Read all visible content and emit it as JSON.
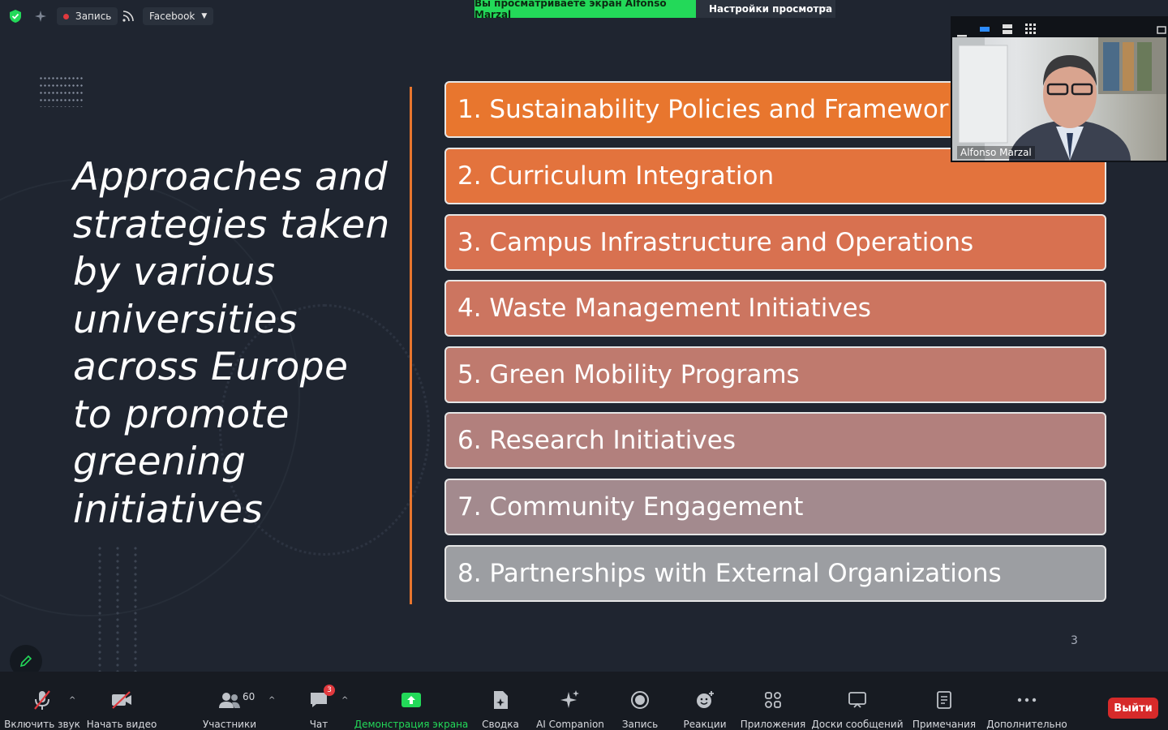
{
  "topbar": {
    "record_label": "Запись",
    "stream_label": "Facebook",
    "share_banner": "Вы просматриваете экран Alfonso Marzal",
    "view_settings": "Настройки просмотра"
  },
  "slide": {
    "title": "Approaches and strategies taken by various universities across Europe to promote greening initiatives",
    "items": [
      {
        "label": "1. Sustainability Policies and Frameworks",
        "color": "#e8762e"
      },
      {
        "label": "2. Curriculum Integration",
        "color": "#e3733d"
      },
      {
        "label": "3. Campus Infrastructure and Operations",
        "color": "#d87150"
      },
      {
        "label": "4. Waste Management Initiatives",
        "color": "#cc7560"
      },
      {
        "label": "5. Green Mobility Programs",
        "color": "#bf7a6e"
      },
      {
        "label": "6. Research Initiatives",
        "color": "#b2807d"
      },
      {
        "label": "7. Community Engagement",
        "color": "#a38a8e"
      },
      {
        "label": "8. Partnerships with External Organizations",
        "color": "#9c9ea2"
      }
    ],
    "page_number": "3"
  },
  "video": {
    "participant_name": "Alfonso Marzal"
  },
  "toolbar": {
    "unmute": "Включить звук",
    "start_video": "Начать видео",
    "participants": "Участники",
    "participants_count": "60",
    "chat": "Чат",
    "chat_badge": "3",
    "share_screen": "Демонстрация экрана",
    "summary": "Сводка",
    "ai_companion": "AI Companion",
    "record": "Запись",
    "reactions": "Реакции",
    "apps": "Приложения",
    "whiteboards": "Доски сообщений",
    "notes": "Примечания",
    "more": "Дополнительно",
    "leave": "Выйти"
  },
  "colors": {
    "accent_orange": "#e8762e",
    "share_green": "#23d959",
    "leave_red": "#d62a2a"
  }
}
